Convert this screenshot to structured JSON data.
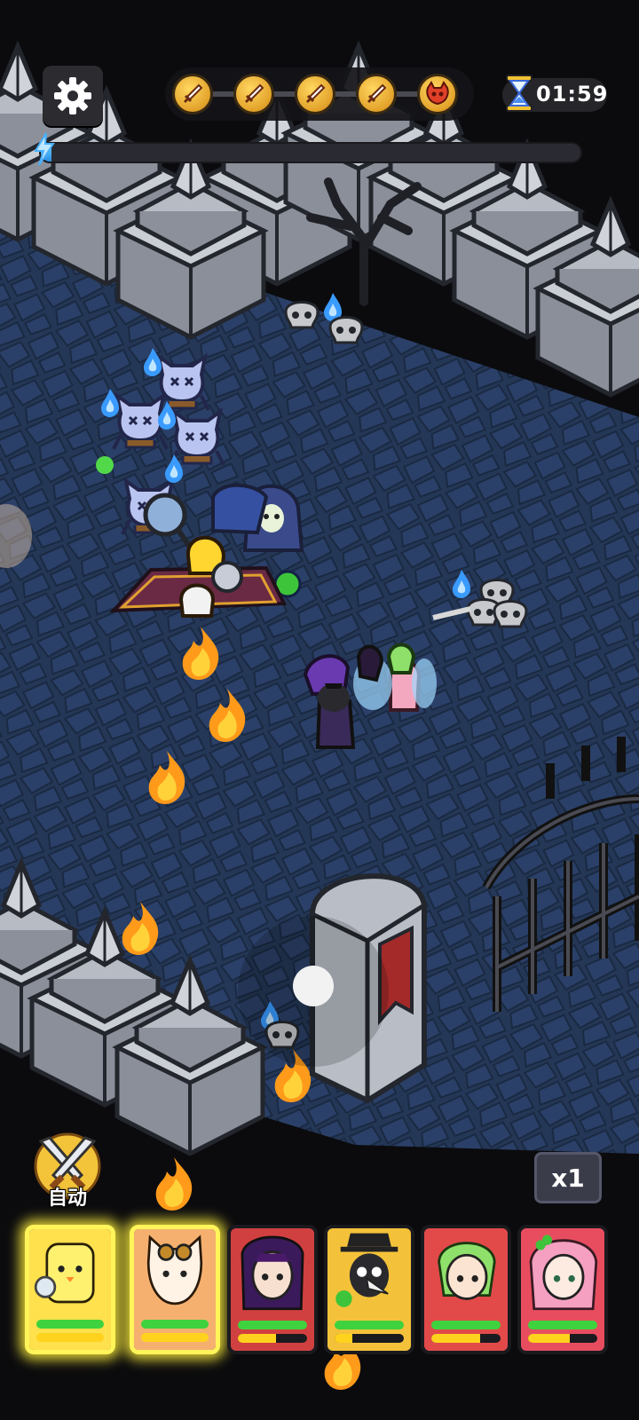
{
  "hud": {
    "settings_icon": "gear-icon",
    "wave_nodes": [
      {
        "icon": "sword-icon",
        "kind": "battle"
      },
      {
        "icon": "sword-icon",
        "kind": "battle"
      },
      {
        "icon": "sword-icon",
        "kind": "battle"
      },
      {
        "icon": "sword-icon",
        "kind": "battle"
      },
      {
        "icon": "boss-skull-icon",
        "kind": "boss"
      }
    ],
    "timer": {
      "icon": "hourglass-icon",
      "text": "01:59"
    },
    "stage_progress": 0.02,
    "auto_button": {
      "icon": "crossed-swords-icon",
      "label": "自动"
    },
    "speed_button": {
      "label": "x1"
    }
  },
  "heroes": [
    {
      "name": "chick-detective",
      "color": "#ffe04d",
      "hp": 1.0,
      "mp": 1.0,
      "selected": true
    },
    {
      "name": "goggles-cat",
      "color": "#f5b070",
      "hp": 1.0,
      "mp": 1.0,
      "selected": true
    },
    {
      "name": "dark-sorceress",
      "color": "#d14040",
      "hp": 1.0,
      "mp": 0.55,
      "selected": false
    },
    {
      "name": "plague-doctor",
      "color": "#f4c23a",
      "hp": 1.0,
      "mp": 0.25,
      "selected": false
    },
    {
      "name": "green-elf",
      "color": "#e24a4a",
      "hp": 1.0,
      "mp": 0.7,
      "selected": false
    },
    {
      "name": "clover-fairy",
      "color": "#e84d5f",
      "hp": 1.0,
      "mp": 0.6,
      "selected": false
    }
  ],
  "colors": {
    "floor": "#223452",
    "floor_tile": "#2c4166",
    "stone": "#b9bec6",
    "hp": "#3fd23f",
    "mp": "#ffd21e",
    "highlight": "#fff45a"
  }
}
